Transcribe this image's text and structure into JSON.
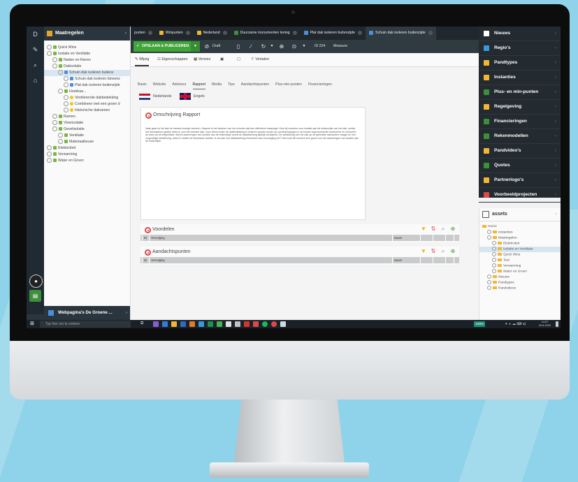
{
  "tree": {
    "header": "Maatregelen",
    "nodes": [
      {
        "label": "Quick Wins",
        "indent": 0,
        "icon": "leaf-icon"
      },
      {
        "label": "Isolatie en Ventilatie",
        "indent": 0,
        "icon": "leaf-icon"
      },
      {
        "label": "Naden en Kieren",
        "indent": 1,
        "icon": "leaf-icon"
      },
      {
        "label": "Dakisolatie",
        "indent": 1,
        "icon": "leaf-icon"
      },
      {
        "label": "Schuin dak isoleren buitenz",
        "indent": 2,
        "icon": "doc-icon",
        "selected": true
      },
      {
        "label": "Schuin dak isoleren binnenz",
        "indent": 3,
        "icon": "doc-icon"
      },
      {
        "label": "Plat dak isoleren buitenzijde",
        "indent": 3,
        "icon": "doc-icon"
      },
      {
        "label": "Hoekkas...",
        "indent": 2,
        "icon": "leaf-icon"
      },
      {
        "label": "Ventilerende dakbedekking",
        "indent": 3,
        "icon": "bulb-icon"
      },
      {
        "label": "Combineer met een groen d",
        "indent": 3,
        "icon": "bulb-icon"
      },
      {
        "label": "Historische dakramen",
        "indent": 3,
        "icon": "bulb-icon"
      },
      {
        "label": "Ramen",
        "indent": 1,
        "icon": "leaf-icon"
      },
      {
        "label": "Vloerisolatie",
        "indent": 1,
        "icon": "leaf-icon"
      },
      {
        "label": "Gevelisolatie",
        "indent": 1,
        "icon": "leaf-icon"
      },
      {
        "label": "Ventilatie",
        "indent": 2,
        "icon": "leaf-icon"
      },
      {
        "label": "Materiaalkeuze",
        "indent": 2,
        "icon": "leaf-icon"
      },
      {
        "label": "Elektriciteit",
        "indent": 0,
        "icon": "leaf-icon"
      },
      {
        "label": "Verwarming",
        "indent": 0,
        "icon": "leaf-icon"
      },
      {
        "label": "Water en Groen",
        "indent": 0,
        "icon": "leaf-icon"
      }
    ],
    "footer": "Webpagina's De Groene ..."
  },
  "tabs": [
    {
      "label": "punten",
      "color": "#8a8a8a"
    },
    {
      "label": "Winpunten",
      "color": "#f2b632"
    },
    {
      "label": "Nederland",
      "color": "#f2b632"
    },
    {
      "label": "Duurzame monumenten lening",
      "color": "#3d8f3a"
    },
    {
      "label": "Plat dak isoleren buitenzijde",
      "color": "#4a90d9"
    },
    {
      "label": "Schuin dak isoleren buitenzijde",
      "color": "#4a90d9",
      "active": true
    }
  ],
  "toolbar": {
    "save_label": "OPSLAAN & PUBLICEREN",
    "draft_label": "Draft",
    "id_label": "ID 224",
    "type_label": "Measure"
  },
  "subbar": {
    "wijzig": "Wijzig",
    "eigenschappen": "Eigenschappen",
    "versies": "Versies",
    "vertalen": "Vertalen"
  },
  "content_tabs": [
    "Basis",
    "Website",
    "Adviseur",
    "Rapport",
    "Media",
    "Tips",
    "Aandachtspunten",
    "Plus-min-punten",
    "Financieringen"
  ],
  "active_content_tab": "Rapport",
  "languages": {
    "nl": "Nederlands",
    "en": "Engels"
  },
  "panel": {
    "title": "Omschrijving Rapport",
    "body": "Vaak gaat nu het dak de meeste energie verloren. Daarom is het isoleren van het schuine dak een effectieve maatregel. Kies bij voorkeur voor isolatie aan de buitenzijde van het dak, omdat het bouwfysisch gezien beter is voor het schuine dak. Door direct onder de dakbedekking te isoleren worden koude op vochtophopingen in de houten kapconstructie voorkomen en reduceert de kans op verveljachtsde. Bij het aanbrengen van isolatie aan de buitenzijde wordt de dakafwerking tijdelijk verwijderd. De aansluiting van het dak op de gebruikte dakranden vraagt om een zorgvuldige detaillering, zeker in relatie tot historische details. Is uw dak met dakafwerking binnenkort aan vervanging toe? Dan kunt dit moment zich goed voor het aanbrengen van isolatie aan de buitenzijde."
  },
  "sections": [
    {
      "title": "Voordelen",
      "col1": "ID",
      "col2": "Vervolging",
      "col3": "Naam"
    },
    {
      "title": "Aandachtspunten",
      "col1": "ID",
      "col2": "Vervolging",
      "col3": "Naam"
    }
  ],
  "right_panel": [
    {
      "label": "Nieuws",
      "color": "#ffffff"
    },
    {
      "label": "Regio's",
      "color": "#3a9ad9"
    },
    {
      "label": "Pandtypes",
      "color": "#f2b632"
    },
    {
      "label": "Instanties",
      "color": "#f2b632"
    },
    {
      "label": "Plus- en min-punten",
      "color": "#3d8f3a"
    },
    {
      "label": "Regelgeving",
      "color": "#f2b632"
    },
    {
      "label": "Financieringen",
      "color": "#3d8f3a"
    },
    {
      "label": "Rekenmodellen",
      "color": "#3d8f3a"
    },
    {
      "label": "Pandvideo's",
      "color": "#f2b632"
    },
    {
      "label": "Quotes",
      "color": "#3d8f3a"
    },
    {
      "label": "Partnerlogo's",
      "color": "#f2b632"
    },
    {
      "label": "Voorbeeldprojecten",
      "color": "#e04848"
    }
  ],
  "assets": {
    "header": "assets",
    "nodes": [
      {
        "label": "Home",
        "indent": 0
      },
      {
        "label": "Instanties",
        "indent": 1
      },
      {
        "label": "Maatregelen",
        "indent": 1
      },
      {
        "label": "Elektriciteit",
        "indent": 2
      },
      {
        "label": "Isolatie en Ventilatie",
        "indent": 2,
        "selected": true
      },
      {
        "label": "Quick Wins",
        "indent": 2
      },
      {
        "label": "Test",
        "indent": 2
      },
      {
        "label": "Verwarming",
        "indent": 2
      },
      {
        "label": "Water en Groen",
        "indent": 2
      },
      {
        "label": "Nieuws",
        "indent": 1
      },
      {
        "label": "Pandtypes",
        "indent": 1
      },
      {
        "label": "Pandvideos",
        "indent": 1
      }
    ]
  },
  "taskbar": {
    "search_placeholder": "Typ hier om te zoeken",
    "time": "14:07",
    "date": "20-6-2020",
    "badge": "100%"
  }
}
